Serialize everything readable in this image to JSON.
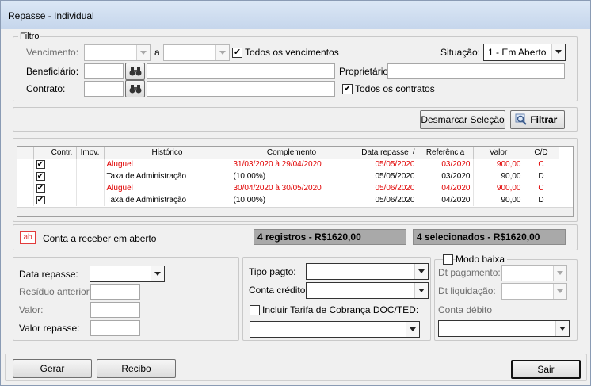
{
  "window": {
    "title": "Repasse - Individual"
  },
  "filtro": {
    "legend": "Filtro",
    "vencimento_label": "Vencimento:",
    "a_label": "a",
    "vencimento_de": "",
    "vencimento_ate": "",
    "todos_vencimentos_label": "Todos os vencimentos",
    "todos_vencimentos_checked": "✔",
    "situacao_label": "Situação:",
    "situacao_value": "1 - Em Aberto",
    "beneficiario_label": "Beneficiário:",
    "proprietario_label": "Proprietário",
    "contrato_label": "Contrato:",
    "todos_contratos_label": "Todos os contratos",
    "todos_contratos_checked": "✔"
  },
  "actions": {
    "desmarcar_label": "Desmarcar Seleção",
    "filtrar_label": "Filtrar"
  },
  "grid": {
    "columns": [
      "",
      "",
      "Contr.",
      "Imov.",
      "Histórico",
      "Complemento",
      "Data repasse",
      "Referência",
      "Valor",
      "C/D"
    ],
    "sort_indicator": "/",
    "rows": [
      {
        "check": "✔",
        "contr": "",
        "imov": "",
        "historico": "Aluguel",
        "complemento": "31/03/2020 à 29/04/2020",
        "data": "05/05/2020",
        "ref": "03/2020",
        "valor": "900,00",
        "cd": "C",
        "red": true
      },
      {
        "check": "✔",
        "contr": "",
        "imov": "",
        "historico": "Taxa de Administração",
        "complemento": "(10,00%)",
        "data": "05/05/2020",
        "ref": "03/2020",
        "valor": "90,00",
        "cd": "D",
        "red": false
      },
      {
        "check": "✔",
        "contr": "",
        "imov": "",
        "historico": "Aluguel",
        "complemento": "30/04/2020 à 30/05/2020",
        "data": "05/06/2020",
        "ref": "04/2020",
        "valor": "900,00",
        "cd": "C",
        "red": true
      },
      {
        "check": "✔",
        "contr": "",
        "imov": "",
        "historico": "Taxa de Administração",
        "complemento": "(10,00%)",
        "data": "05/06/2020",
        "ref": "04/2020",
        "valor": "90,00",
        "cd": "D",
        "red": false
      }
    ]
  },
  "status": {
    "badge": "ab",
    "conta_label": "Conta a receber em aberto",
    "registros": "4 registros - R$1620,00",
    "selecionados": "4 selecionados - R$1620,00"
  },
  "repasse": {
    "data_label": "Data repasse:",
    "residuo_label": "Resíduo anterior:",
    "valor_label": "Valor:",
    "valor_repasse_label": "Valor repasse:"
  },
  "pagto": {
    "tipo_label": "Tipo pagto:",
    "conta_credito_label": "Conta crédito:",
    "incluir_tarifa_label": "Incluir Tarifa de Cobrança DOC/TED:"
  },
  "baixa": {
    "modo_label": "Modo baixa",
    "dt_pagamento_label": "Dt pagamento:",
    "dt_liquidacao_label": "Dt liquidação:",
    "conta_debito_label": "Conta débito"
  },
  "footer": {
    "gerar_label": "Gerar",
    "recibo_label": "Recibo",
    "sair_label": "Sair"
  },
  "colors": {
    "red_text": "#e00000",
    "summary_bg": "#a9a9a9"
  }
}
